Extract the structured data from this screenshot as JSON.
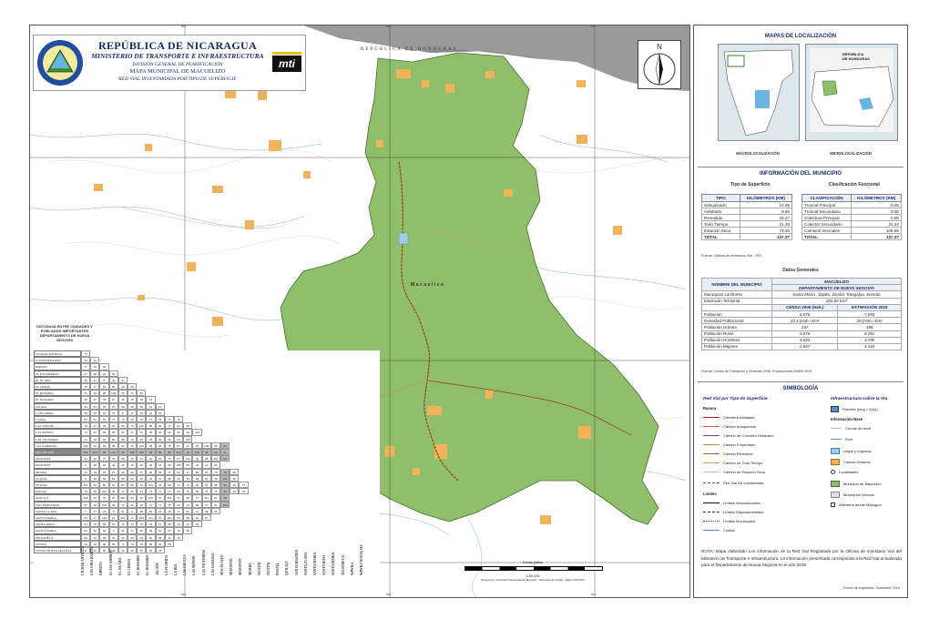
{
  "header": {
    "country": "REPÚBLICA DE NICARAGUA",
    "ministry": "MINISTERIO DE TRANSPORTE E INFRAESTRUCTURA",
    "division": "DIVISIÓN GENERAL DE PLANIFICACIÓN",
    "map_title": "MAPA MUNICIPAL DE MACUELIZO",
    "subtitle": "RED VIAL INVENTARIADA POR TIPO DE SUPERFICIE",
    "logo_text": "mti"
  },
  "map": {
    "neighbor_label": "REPÚBLICA DE HONDURAS",
    "north_label": "N",
    "municipality_label": "Macuelizo",
    "colors": {
      "municipality": "#8fbf6a",
      "urban": "#f2b25a",
      "roads": "#9c3b2b",
      "rivers": "#7db3d8",
      "outside": "#9a9a9a",
      "background": "#ffffff"
    },
    "top_coords": [
      "555",
      "560",
      "565"
    ],
    "bottom_coords": [
      "555",
      "560",
      "565"
    ]
  },
  "distance_table": {
    "title": "DISTANCIA ENTRE CIUDADES Y POBLADOS IMPORTANTES DEPARTAMENTO DE NUEVA SEGOVIA",
    "places": [
      "CIUDAD ANTIGUA",
      "COLONIA RAMOS",
      "DIPILTO",
      "EL ESCAMBRAY",
      "EL JICARO",
      "EL LIMON",
      "EL ROSARIO",
      "EL ROSARIO",
      "JALAPA",
      "LA FLORIDA",
      "LA RIA",
      "LAS CRUCES",
      "LAS MANOS",
      "LAS VICTORIAS",
      "LAS SABANAS",
      "MACUELIZO",
      "MOZONTE",
      "MOZONTE",
      "MURRA",
      "OCOTAL",
      "OCOTAL",
      "PANALI",
      "QUILALÍ",
      "SAN FERNANDO",
      "SANTA CLARA",
      "SANTA MARIA",
      "SANTA ROSA",
      "SANTA MARIA",
      "TELPANECA",
      "WIWILI",
      "WIWILI NUEVA SEGOVIA"
    ],
    "highlight_index": 15,
    "rows": [
      [
        "73"
      ],
      [
        "44",
        "34"
      ],
      [
        "37",
        "16",
        "32"
      ],
      [
        "27",
        "56",
        "43",
        "30"
      ],
      [
        "38",
        "47",
        "6",
        "42",
        "37"
      ],
      [
        "25",
        "77",
        "64",
        "50",
        "20",
        "46"
      ],
      [
        "51",
        "49",
        "28",
        "104",
        "65",
        "71",
        "52"
      ],
      [
        "48",
        "57",
        "78",
        "27",
        "18",
        "18",
        "35",
        "79"
      ],
      [
        "34",
        "61",
        "30",
        "16",
        "39",
        "18",
        "48",
        "21",
        "12"
      ],
      [
        "18",
        "55",
        "61",
        "37",
        "8",
        "17",
        "18",
        "21",
        "22"
      ],
      [
        "86",
        "51",
        "63",
        "74",
        "75",
        "54",
        "16",
        "74",
        "66",
        "77",
        "76"
      ],
      [
        "49",
        "47",
        "43",
        "32",
        "55",
        "74",
        "122",
        "86",
        "90",
        "74",
        "90",
        "93"
      ],
      [
        "70",
        "64",
        "45",
        "85",
        "66",
        "47",
        "37",
        "38",
        "32",
        "64",
        "42",
        "34",
        "119"
      ],
      [
        "71",
        "19",
        "60",
        "80",
        "98",
        "72",
        "90",
        "35",
        "42",
        "54",
        "53",
        "133"
      ],
      [
        "100",
        "84",
        "52",
        "98",
        "94",
        "75",
        "126",
        "44",
        "65",
        "75",
        "87",
        "27",
        "35",
        "135",
        "52",
        "83"
      ],
      [
        "101",
        "100",
        "96",
        "101",
        "25",
        "106",
        "100",
        "89",
        "86",
        "88",
        "112",
        "10",
        "101",
        "96",
        "99",
        "91"
      ],
      [
        "44",
        "46",
        "37",
        "79",
        "68",
        "43",
        "52",
        "61",
        "61",
        "75",
        "27",
        "111",
        "31",
        "28",
        "161",
        "111"
      ],
      [
        "6",
        "38",
        "32",
        "42",
        "26",
        "15",
        "60",
        "46",
        "15",
        "35",
        "105",
        "59",
        "22",
        "11",
        "89"
      ],
      [
        "33",
        "29",
        "19",
        "13",
        "48",
        "26",
        "67",
        "94",
        "59",
        "75",
        "63",
        "47",
        "80",
        "20",
        "78",
        "76",
        "89"
      ],
      [
        "8",
        "80",
        "62",
        "84",
        "50",
        "53",
        "46",
        "44",
        "47",
        "58",
        "43",
        "34",
        "54",
        "10",
        "38",
        "141",
        "92"
      ],
      [
        "101",
        "90",
        "89",
        "87",
        "107",
        "89",
        "81",
        "101",
        "84",
        "112",
        "72",
        "17",
        "46",
        "55",
        "88",
        "21",
        "15",
        "77"
      ],
      [
        "72",
        "30",
        "102",
        "45",
        "72",
        "90",
        "64",
        "74",
        "77",
        "77",
        "64",
        "72",
        "86",
        "75",
        "15",
        "44",
        "44",
        "21"
      ],
      [
        "118",
        "69",
        "76",
        "23",
        "184",
        "84",
        "65",
        "133",
        "97",
        "115",
        "97",
        "98",
        "17",
        "111",
        "84",
        "35"
      ],
      [
        "97",
        "29",
        "102",
        "49",
        "73",
        "90",
        "65",
        "74",
        "77",
        "78",
        "64",
        "72",
        "68",
        "47",
        "31",
        "124"
      ],
      [
        "7",
        "37",
        "91",
        "9",
        "61",
        "9",
        "49",
        "69",
        "62",
        "40",
        "8",
        "92",
        "11",
        "69",
        "32"
      ],
      [
        "63",
        "27",
        "129",
        "12",
        "164",
        "74",
        "103",
        "131",
        "57",
        "115",
        "63",
        "68",
        "67",
        "57"
      ],
      [
        "63",
        "70",
        "68",
        "52",
        "75",
        "12",
        "75",
        "61",
        "57",
        "68",
        "12",
        "44",
        "34"
      ],
      [
        "50",
        "52",
        "66",
        "2",
        "62",
        "17",
        "50",
        "69",
        "30",
        "53",
        "16",
        "59"
      ],
      [
        "68",
        "12",
        "68",
        "31",
        "43",
        "59",
        "84",
        "52",
        "58",
        "33",
        "19"
      ],
      [
        "44",
        "28",
        "36",
        "50",
        "3",
        "70",
        "15",
        "56",
        "39",
        "58"
      ],
      [
        "8",
        "66",
        "96",
        "26",
        "32",
        "45",
        "66",
        "54",
        "18"
      ]
    ]
  },
  "scale": {
    "label": "Escala gráfica",
    "ratio": "1:50,000",
    "projection": "Proyección Universal Transversal de Mercator - Elipsoide de Clarke - Datum WGS 84"
  },
  "sidebar": {
    "location_title": "MAPAS DE LOCALIZACIÓN",
    "macro_caption": "MACROLOCALIZACIÓN",
    "micro_caption": "MICROLOCALIZACIÓN",
    "inset_label_1": "REPÚBLICA",
    "inset_label_2": "DE HONDURAS",
    "info_title": "INFORMACIÓN DEL MUNICIPIO",
    "surface_sub": "Tipo de Superficie",
    "functional_sub": "Clasificación Funcional",
    "surface_headers": {
      "type": "TIPO",
      "km": "KILÓMETROS (KM)"
    },
    "functional_headers": {
      "class": "CLASIFICACIÓN",
      "km": "KILÓMETROS (KM)"
    },
    "surface_rows": [
      {
        "name": "Adoquinado",
        "km": "12.35"
      },
      {
        "name": "Asfaltado",
        "km": "9.69"
      },
      {
        "name": "Revestido",
        "km": "18.27"
      },
      {
        "name": "Todo Tiempo",
        "km": "21.30"
      },
      {
        "name": "Estación Seca",
        "km": "74.36"
      }
    ],
    "surface_total": {
      "name": "TOTAL",
      "km": "137.27"
    },
    "functional_rows": [
      {
        "name": "Troncal Principal",
        "km": "0.00"
      },
      {
        "name": "Troncal Secundaria",
        "km": "0.00"
      },
      {
        "name": "Colectora Principal",
        "km": "0.00"
      },
      {
        "name": "Colector Secundario",
        "km": "31.32"
      },
      {
        "name": "Caminos Vecinales",
        "km": "105.96"
      }
    ],
    "functional_total": {
      "name": "TOTAL",
      "km": "137.27"
    },
    "fuente_1": "Fuente: Oficina de Inventario Vial - MTI.",
    "datos_title": "Datos Generales",
    "datos_header_left": "NOMBRE DEL MUNICIPIO",
    "datos_header_right_1": "MACUELIZO",
    "datos_header_right_2": "DEPARTAMENTO DE NUEVA SEGOVIA",
    "limitrofes_label": "Municipios Limítrofes",
    "limitrofes_value": "Santa María , Dipilto, Ocotal, Totogalpa, Somoto",
    "extension_label": "Extensión Territorial",
    "extension_value": "204.84 Km²",
    "censo_1": "CENSO 2005 (Hab.)",
    "censo_2": "ESTIMACIÓN 2019",
    "pop_rows": [
      {
        "label": "Población",
        "v1": "6,076",
        "v2": "7,050"
      },
      {
        "label": "Densidad Poblacional",
        "v1": "23.4 (Hab / Km²",
        "v2": "28 (Hab / Km²"
      },
      {
        "label": "Población Urbana",
        "v1": "247",
        "v2": "498"
      },
      {
        "label": "Población Rural",
        "v1": "5,874",
        "v2": "6,252"
      },
      {
        "label": "Población Hombres",
        "v1": "4,224",
        "v2": "3,705"
      },
      {
        "label": "Población Mujeres",
        "v1": "2,857",
        "v2": "3,344"
      }
    ],
    "fuente_2": "Fuente: Censo de Población y Vivienda 2005, Proyecciones INIDE 2019",
    "simbologia_title": "SIMBOLOGÍA",
    "red_vial_title": "Red Vial por Tipo de Superficie",
    "infra_title": "Infraestructura sobre la Vía",
    "rasura_label": "Rasura",
    "road_types": [
      {
        "label": "Carretera Asfaltada",
        "color": "#b01a1a"
      },
      {
        "label": "Camino Adoquinado",
        "color": "#d94c4c"
      },
      {
        "label": "Camino de Concreto Hidráulico",
        "color": "#8a3d9a"
      },
      {
        "label": "Camino Empedrado",
        "color": "#c8843c"
      },
      {
        "label": "Camino Revestido",
        "color": "#a06b2a"
      },
      {
        "label": "Camino de Todo Tiempo",
        "color": "#d6a35c"
      },
      {
        "label": "Camino de Estación Seca",
        "color": "#e8b49c"
      }
    ],
    "red_vial_no_inventariada": "Red Vial No Inventariada",
    "limites_title": "Límites",
    "limits": [
      {
        "label": "Límites Internacionales"
      },
      {
        "label": "Límites Departamentales"
      },
      {
        "label": "Límites Municipales"
      },
      {
        "label": "Costas"
      }
    ],
    "infra_items": [
      {
        "label": "Puentes (long > 6(m))"
      }
    ],
    "info_basica_title": "Información Base",
    "info_basica": [
      {
        "label": "Curvas de Nivel"
      },
      {
        "label": "Ríos"
      },
      {
        "label": "Lagos y Lagunas"
      },
      {
        "label": "Cascos Urbanos"
      },
      {
        "label": "Localidades"
      },
      {
        "label": "Municipio de Macuelizo"
      },
      {
        "label": "Municipios Vecinos"
      },
      {
        "label": "Altimetría desde Managua"
      }
    ],
    "nota": "NOTA: Mapa elaborado con información de la Red Vial Registrada por la Oficina de Inventario Vial del Ministerio de Transporte e Infraestructura. La información presentada corresponde a la Red Vial actualizada para el Departamento de Nueva Segovia en el año 2018.",
    "fecha": "Fecha de impresión: Diciembre 2019"
  }
}
